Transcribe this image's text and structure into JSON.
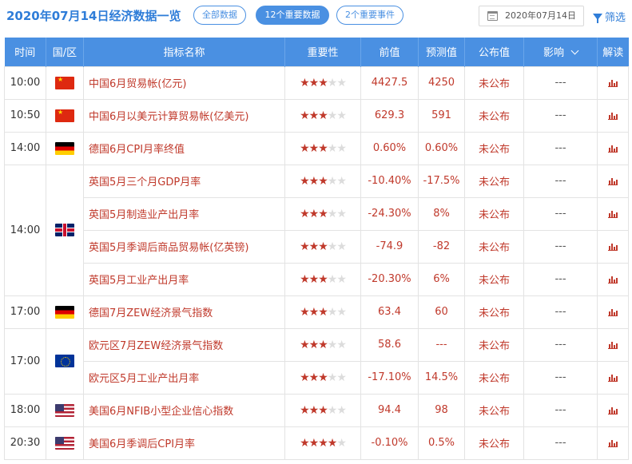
{
  "header": {
    "title": "2020年07月14日经济数据一览",
    "filters": {
      "all": "全部数据",
      "important": "12个重要数据",
      "events": "2个重要事件"
    },
    "date": "2020年07月14日",
    "filter_label": "筛选"
  },
  "columns": {
    "time": "时间",
    "region": "国/区",
    "name": "指标名称",
    "importance": "重要性",
    "prev": "前值",
    "forecast": "预测值",
    "actual": "公布值",
    "impact": "影响",
    "interpret": "解读"
  },
  "rows": [
    {
      "time": "10:00",
      "flag": "cn-flag-icon",
      "name": "中国6月贸易帐(亿元)",
      "stars": 3,
      "prev": "4427.5",
      "forecast": "4250",
      "actual": "未公布",
      "impact": "---"
    },
    {
      "time": "10:50",
      "flag": "cn-flag-icon",
      "name": "中国6月以美元计算贸易帐(亿美元)",
      "stars": 3,
      "prev": "629.3",
      "forecast": "591",
      "actual": "未公布",
      "impact": "---"
    },
    {
      "time": "14:00",
      "flag": "de-flag-icon",
      "name": "德国6月CPI月率终值",
      "stars": 3,
      "prev": "0.60%",
      "forecast": "0.60%",
      "actual": "未公布",
      "impact": "---"
    },
    {
      "time": "14:00",
      "flag": "gb-flag-icon",
      "name": "英国5月三个月GDP月率",
      "stars": 3,
      "prev": "-10.40%",
      "forecast": "-17.5%",
      "actual": "未公布",
      "impact": "---"
    },
    {
      "name": "英国5月制造业产出月率",
      "stars": 3,
      "prev": "-24.30%",
      "forecast": "8%",
      "actual": "未公布",
      "impact": "---"
    },
    {
      "name": "英国5月季调后商品贸易帐(亿英镑)",
      "stars": 3,
      "prev": "-74.9",
      "forecast": "-82",
      "actual": "未公布",
      "impact": "---"
    },
    {
      "name": "英国5月工业产出月率",
      "stars": 3,
      "prev": "-20.30%",
      "forecast": "6%",
      "actual": "未公布",
      "impact": "---"
    },
    {
      "time": "17:00",
      "flag": "de-flag-icon",
      "name": "德国7月ZEW经济景气指数",
      "stars": 3,
      "prev": "63.4",
      "forecast": "60",
      "actual": "未公布",
      "impact": "---"
    },
    {
      "time": "17:00",
      "flag": "eu-flag-icon",
      "name": "欧元区7月ZEW经济景气指数",
      "stars": 3,
      "prev": "58.6",
      "forecast": "---",
      "actual": "未公布",
      "impact": "---"
    },
    {
      "name": "欧元区5月工业产出月率",
      "stars": 3,
      "prev": "-17.10%",
      "forecast": "14.5%",
      "actual": "未公布",
      "impact": "---"
    },
    {
      "time": "18:00",
      "flag": "us-flag-icon",
      "name": "美国6月NFIB小型企业信心指数",
      "stars": 3,
      "prev": "94.4",
      "forecast": "98",
      "actual": "未公布",
      "impact": "---"
    },
    {
      "time": "20:30",
      "flag": "us-flag-icon",
      "name": "美国6月季调后CPI月率",
      "stars": 4,
      "prev": "-0.10%",
      "forecast": "0.5%",
      "actual": "未公布",
      "impact": "---"
    }
  ]
}
